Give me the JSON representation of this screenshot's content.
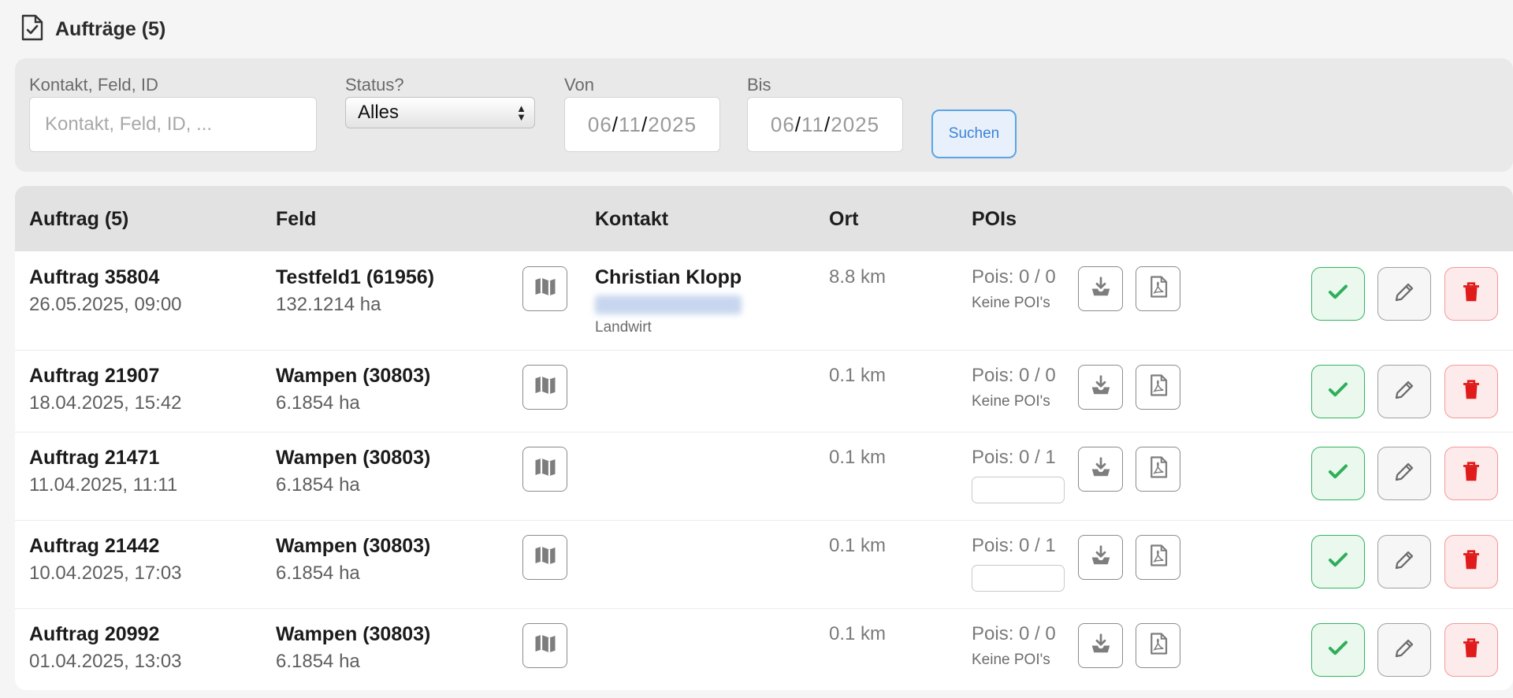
{
  "header": {
    "title": "Aufträge (5)",
    "icon": "document-check-icon"
  },
  "filters": {
    "search_label": "Kontakt, Feld, ID",
    "search_placeholder": "Kontakt, Feld, ID, ...",
    "status_label": "Status?",
    "status_value": "Alles",
    "from_label": "Von",
    "from_value": {
      "day": "06",
      "month": "11",
      "year": "2025"
    },
    "to_label": "Bis",
    "to_value": {
      "day": "06",
      "month": "11",
      "year": "2025"
    },
    "search_button": "Suchen"
  },
  "table": {
    "headers": {
      "order": "Auftrag (5)",
      "field": "Feld",
      "contact": "Kontakt",
      "location": "Ort",
      "pois": "POIs"
    },
    "rows": [
      {
        "title": "Auftrag 35804",
        "date": "26.05.2025, 09:00",
        "field": "Testfeld1 (61956)",
        "area": "132.1214 ha",
        "contact_name": "Christian Klopp",
        "contact_role": "Landwirt",
        "distance": "8.8 km",
        "pois": "Pois: 0 / 0",
        "pois_note": "Keine POI's"
      },
      {
        "title": "Auftrag 21907",
        "date": "18.04.2025, 15:42",
        "field": "Wampen (30803)",
        "area": "6.1854 ha",
        "contact_name": "",
        "contact_role": "",
        "distance": "0.1 km",
        "pois": "Pois: 0 / 0",
        "pois_note": "Keine POI's"
      },
      {
        "title": "Auftrag 21471",
        "date": "11.04.2025, 11:11",
        "field": "Wampen (30803)",
        "area": "6.1854 ha",
        "contact_name": "",
        "contact_role": "",
        "distance": "0.1 km",
        "pois": "Pois: 0 / 1",
        "pois_note": ""
      },
      {
        "title": "Auftrag 21442",
        "date": "10.04.2025, 17:03",
        "field": "Wampen (30803)",
        "area": "6.1854 ha",
        "contact_name": "",
        "contact_role": "",
        "distance": "0.1 km",
        "pois": "Pois: 0 / 1",
        "pois_note": ""
      },
      {
        "title": "Auftrag 20992",
        "date": "01.04.2025, 13:03",
        "field": "Wampen (30803)",
        "area": "6.1854 ha",
        "contact_name": "",
        "contact_role": "",
        "distance": "0.1 km",
        "pois": "Pois: 0 / 0",
        "pois_note": "Keine POI's"
      }
    ]
  },
  "icons": {
    "map": "map-icon",
    "download": "download-icon",
    "pdf": "pdf-icon",
    "done": "check-icon",
    "edit": "pencil-icon",
    "delete": "trash-icon"
  },
  "colors": {
    "done": "#2fae5a",
    "delete": "#e01b1b",
    "accent": "#3b82d9"
  }
}
